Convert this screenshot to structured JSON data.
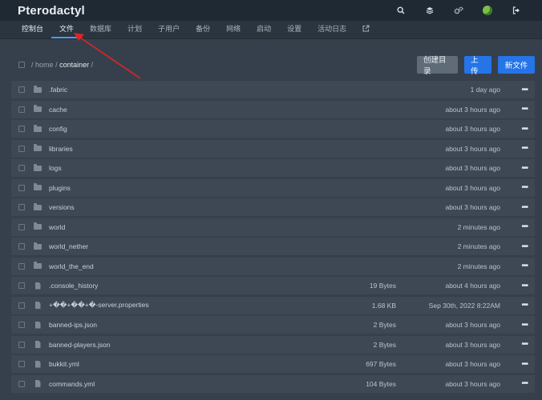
{
  "app": {
    "title": "Pterodactyl"
  },
  "header_icons": [
    "search-icon",
    "layers-icon",
    "cogs-icon",
    "avatar",
    "logout-icon"
  ],
  "nav": {
    "tabs": [
      {
        "label": "控制台"
      },
      {
        "label": "文件"
      },
      {
        "label": "数据库"
      },
      {
        "label": "计划"
      },
      {
        "label": "子用户"
      },
      {
        "label": "备份"
      },
      {
        "label": "网络"
      },
      {
        "label": "启动"
      },
      {
        "label": "设置"
      },
      {
        "label": "活动日志"
      }
    ],
    "external_icon": "external-link-icon"
  },
  "breadcrumb": {
    "sep": "/",
    "root": "home",
    "current": "container",
    "trail_sep": "/"
  },
  "actions": {
    "mkdir": "创建目录",
    "upload": "上传",
    "new_file": "新文件"
  },
  "colors": {
    "accent": "#2574e8",
    "annotation": "#e02424"
  },
  "files": [
    {
      "type": "folder",
      "name": ".fabric",
      "size": "",
      "modified": "1 day ago"
    },
    {
      "type": "folder",
      "name": "cache",
      "size": "",
      "modified": "about 3 hours ago"
    },
    {
      "type": "folder",
      "name": "config",
      "size": "",
      "modified": "about 3 hours ago"
    },
    {
      "type": "folder",
      "name": "libraries",
      "size": "",
      "modified": "about 3 hours ago"
    },
    {
      "type": "folder",
      "name": "logs",
      "size": "",
      "modified": "about 3 hours ago"
    },
    {
      "type": "folder",
      "name": "plugins",
      "size": "",
      "modified": "about 3 hours ago"
    },
    {
      "type": "folder",
      "name": "versions",
      "size": "",
      "modified": "about 3 hours ago"
    },
    {
      "type": "folder",
      "name": "world",
      "size": "",
      "modified": "2 minutes ago"
    },
    {
      "type": "folder",
      "name": "world_nether",
      "size": "",
      "modified": "2 minutes ago"
    },
    {
      "type": "folder",
      "name": "world_the_end",
      "size": "",
      "modified": "2 minutes ago"
    },
    {
      "type": "file",
      "name": ".console_history",
      "size": "19 Bytes",
      "modified": "about 4 hours ago"
    },
    {
      "type": "file",
      "name": "+��+��+�-server.properties",
      "size": "1.68 KB",
      "modified": "Sep 30th, 2022 8:22AM"
    },
    {
      "type": "file",
      "name": "banned-ips.json",
      "size": "2 Bytes",
      "modified": "about 3 hours ago"
    },
    {
      "type": "file",
      "name": "banned-players.json",
      "size": "2 Bytes",
      "modified": "about 3 hours ago"
    },
    {
      "type": "file",
      "name": "bukkit.yml",
      "size": "697 Bytes",
      "modified": "about 3 hours ago"
    },
    {
      "type": "file",
      "name": "commands.yml",
      "size": "104 Bytes",
      "modified": "about 3 hours ago"
    }
  ],
  "row_menu": "•••"
}
